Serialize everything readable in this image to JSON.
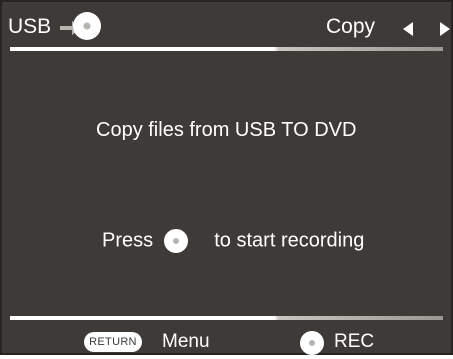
{
  "header": {
    "source": "USB",
    "source_icon": "arrow-icon",
    "target_icon": "disc-icon",
    "mode": "Copy",
    "prev_icon": "triangle-left-icon",
    "next_icon": "triangle-right-icon"
  },
  "main": {
    "message": "Copy files from USB TO DVD",
    "press_prefix": "Press",
    "press_suffix": "to start recording",
    "press_icon": "record-button-icon"
  },
  "footer": {
    "return_key": "RETURN",
    "menu_label": "Menu",
    "rec_icon": "record-button-icon",
    "rec_label": "REC"
  },
  "colors": {
    "background": "#3d3a37",
    "text": "#ffffff",
    "rule": "#ffffff"
  }
}
